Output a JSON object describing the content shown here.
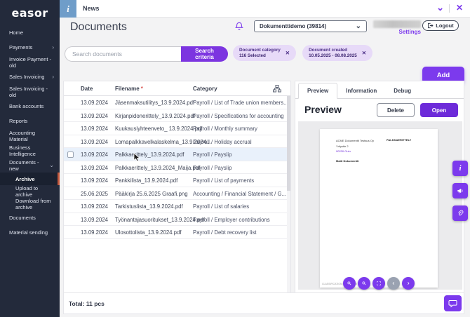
{
  "colors": {
    "accent": "#7c3aed",
    "accent_dark": "#6d2bd9",
    "sidebar_bg": "#232a3b",
    "active_item_bar": "#c2573c",
    "chip_bg": "#e7daf8",
    "selected_row_bg": "#e9f1fb",
    "news_info_bg": "#6f9dc9"
  },
  "icons": {
    "news_info": "info-icon",
    "collapse": "chevron-down-icon",
    "close": "close-icon",
    "bell": "notifications-bell-icon",
    "logout": "logout-arrow-icon",
    "sitemap": "category-tree-icon",
    "zoom_in": "magnifier-plus-icon",
    "zoom_out": "magnifier-minus-icon",
    "fit": "fit-screen-icon",
    "prev": "chevron-left-icon",
    "next": "chevron-right-icon",
    "info_rail": "info-icon",
    "megaphone": "megaphone-icon",
    "attachment": "paperclip-icon",
    "chat": "speech-bubble-icon",
    "cursor": "mouse-cursor"
  },
  "sidebar": {
    "logo": "easor",
    "items": [
      {
        "label": "Home"
      },
      {
        "label": "Payments",
        "chevron": "›"
      },
      {
        "label": "Invoice Payment - old"
      },
      {
        "label": "Sales Invoicing",
        "chevron": "›"
      },
      {
        "label": "Sales Invoicing - old"
      },
      {
        "label": "Bank accounts"
      },
      {
        "label": "Reports"
      },
      {
        "label": "Accounting Material"
      },
      {
        "label": "Business Intelligence"
      },
      {
        "label": "Documents - new",
        "chevron": "⌄"
      },
      {
        "label": "Archive",
        "child": true,
        "active": true
      },
      {
        "label": "Upload to archive",
        "child": true
      },
      {
        "label": "Download from archive",
        "child": true
      },
      {
        "label": "Documents"
      },
      {
        "label": "Material sending"
      }
    ]
  },
  "news_bar": {
    "info_glyph": "i",
    "label": "News",
    "collapse_glyph": "⌄",
    "close_glyph": "✕"
  },
  "header": {
    "title": "Documents",
    "company_dropdown": {
      "value": "Dokumenttidemo (39814)",
      "chevron": "⌄"
    },
    "settings_label": "Settings",
    "logout_label": "Logout"
  },
  "search": {
    "placeholder": "Search documents",
    "criteria_button": "Search criteria",
    "chips": [
      {
        "title": "Document category",
        "value": "116 Selected",
        "remove_glyph": "✕"
      },
      {
        "title": "Document created",
        "value": "10.05.2025 - 08.08.2025",
        "remove_glyph": "✕"
      }
    ]
  },
  "actions": {
    "add_label": "Add"
  },
  "table": {
    "columns": {
      "date": "Date",
      "filename": "Filename",
      "category": "Category"
    },
    "sort_marker": "*",
    "rows": [
      {
        "date": "13.09.2024",
        "filename": "Jäsenmaksutilitys_13.9.2024.pdf",
        "category": "Payroll / List of Trade union members..."
      },
      {
        "date": "13.09.2024",
        "filename": "Kirjanpidonerittely_13.9.2024.pdf",
        "category": "Payroll / Specifications for accounting"
      },
      {
        "date": "13.09.2024",
        "filename": "Kuukausiyhteenveto_ 13.9.2024.pdf",
        "category": "Payroll / Monthly summary"
      },
      {
        "date": "13.09.2024",
        "filename": "Lomapalkkavelkalaskelma_13.9.2024...",
        "category": "Payroll / Holiday accrual"
      },
      {
        "date": "13.09.2024",
        "filename": "Palkkaerittely_13.9.2024.pdf",
        "category": "Payroll / Payslip",
        "selected": true
      },
      {
        "date": "13.09.2024",
        "filename": "Palkkaerittely_13.9.2024_Maija.pdf",
        "category": "Payroll / Payslip"
      },
      {
        "date": "13.09.2024",
        "filename": "Pankkilista_13.9.2024.pdf",
        "category": "Payroll / List of payments"
      },
      {
        "date": "25.06.2025",
        "filename": "Pääkirja 25.6.2025 Graafi.png",
        "category": "Accounting / Financial Statement / G..."
      },
      {
        "date": "13.09.2024",
        "filename": "Tarkistuslista_13.9.2024.pdf",
        "category": "Payroll / List of salaries"
      },
      {
        "date": "13.09.2024",
        "filename": "Työnantajasuoritukset_13.9.2024.pdf",
        "category": "Payroll / Employer contributions"
      },
      {
        "date": "13.09.2024",
        "filename": "Ulosottolista_13.9.2024.pdf",
        "category": "Payroll / Debt recovery list"
      }
    ],
    "total": "Total: 11 pcs"
  },
  "preview_panel": {
    "tabs": [
      {
        "label": "Preview",
        "active": true
      },
      {
        "label": "Information"
      },
      {
        "label": "Debug"
      }
    ],
    "heading": "Preview",
    "delete_button": "Delete",
    "open_button": "Open",
    "document": {
      "company_name": "ACME Dokumentti Testaus Oy",
      "address_line": "Yritystie 2",
      "city_line": "90230 Oulu",
      "doc_type": "PALKKAERITTELY",
      "recipient": "Matti Dokumentti",
      "footer_note": "CLASSIFICATION: CONFIDENTIAL"
    }
  }
}
